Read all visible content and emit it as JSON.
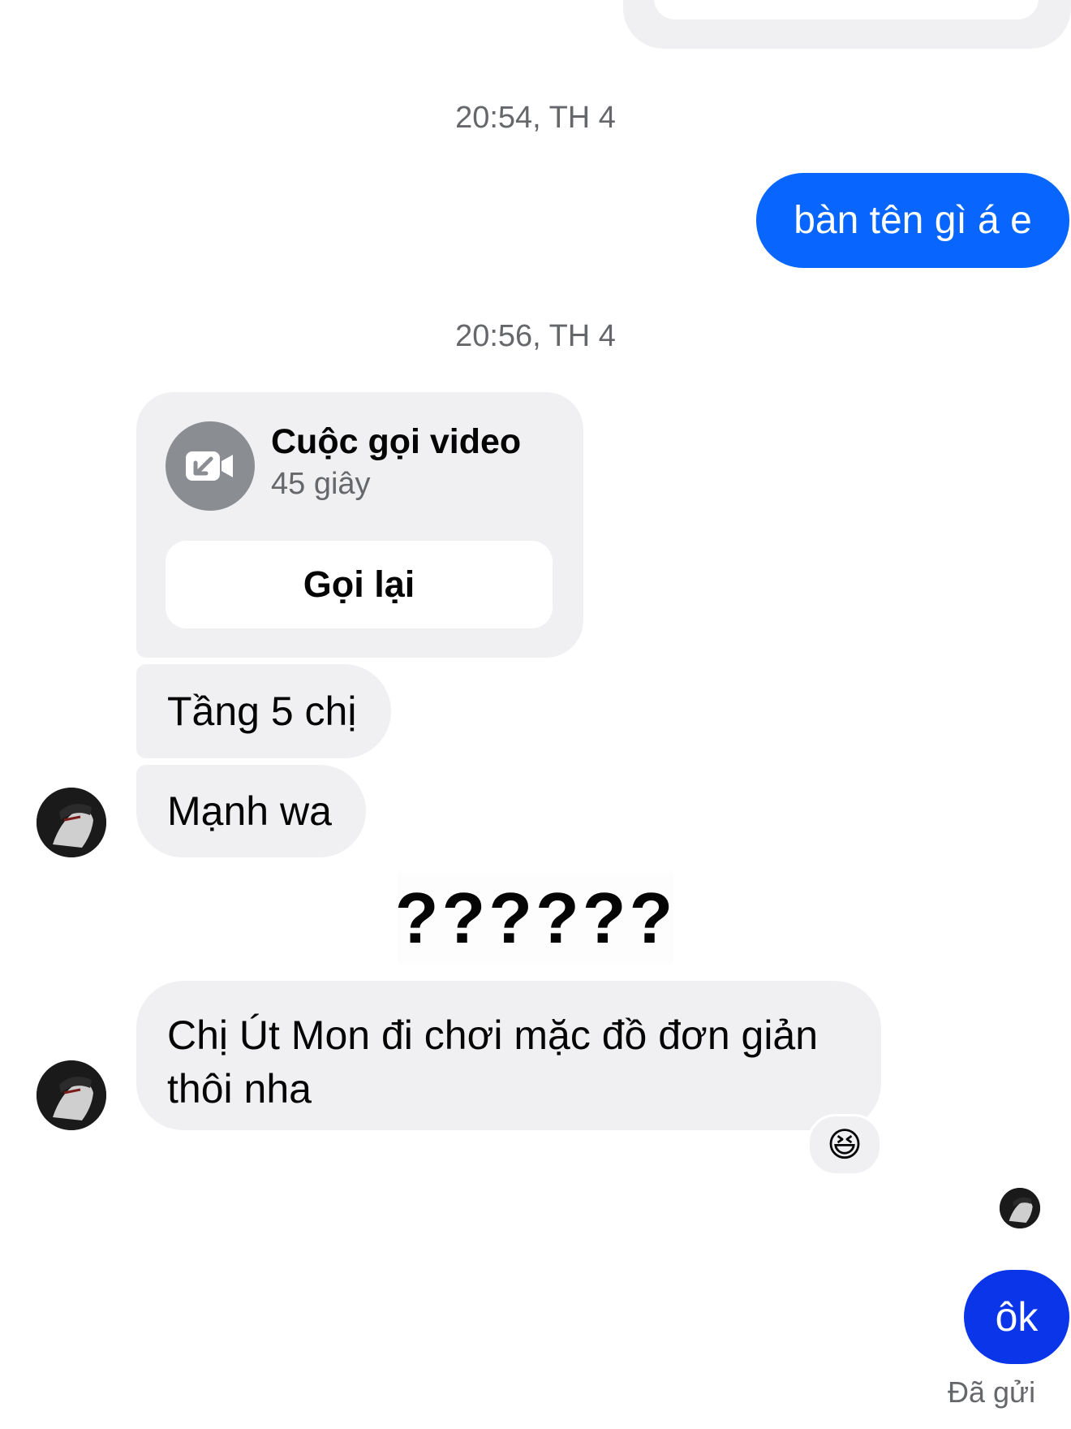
{
  "conversation": {
    "timestamps": [
      "20:54, TH 4",
      "20:56, TH 4"
    ],
    "sent_messages": [
      "bàn tên gì á e",
      "ôk"
    ],
    "call": {
      "title": "Cuộc gọi video",
      "duration": "45 giây",
      "callback_label": "Gọi lại",
      "icon": "video-camera-incoming-icon"
    },
    "received_messages": [
      "Tầng 5 chị",
      "Mạnh wa",
      "??????",
      "Chị Út Mon đi chơi mặc đồ đơn giản thôi nha"
    ],
    "reaction_emoji": "😆",
    "status": "Đã gửi"
  },
  "colors": {
    "sent_bubble": "#0866ff",
    "received_bubble": "#f0f0f2",
    "secondary_text": "#65676b"
  }
}
